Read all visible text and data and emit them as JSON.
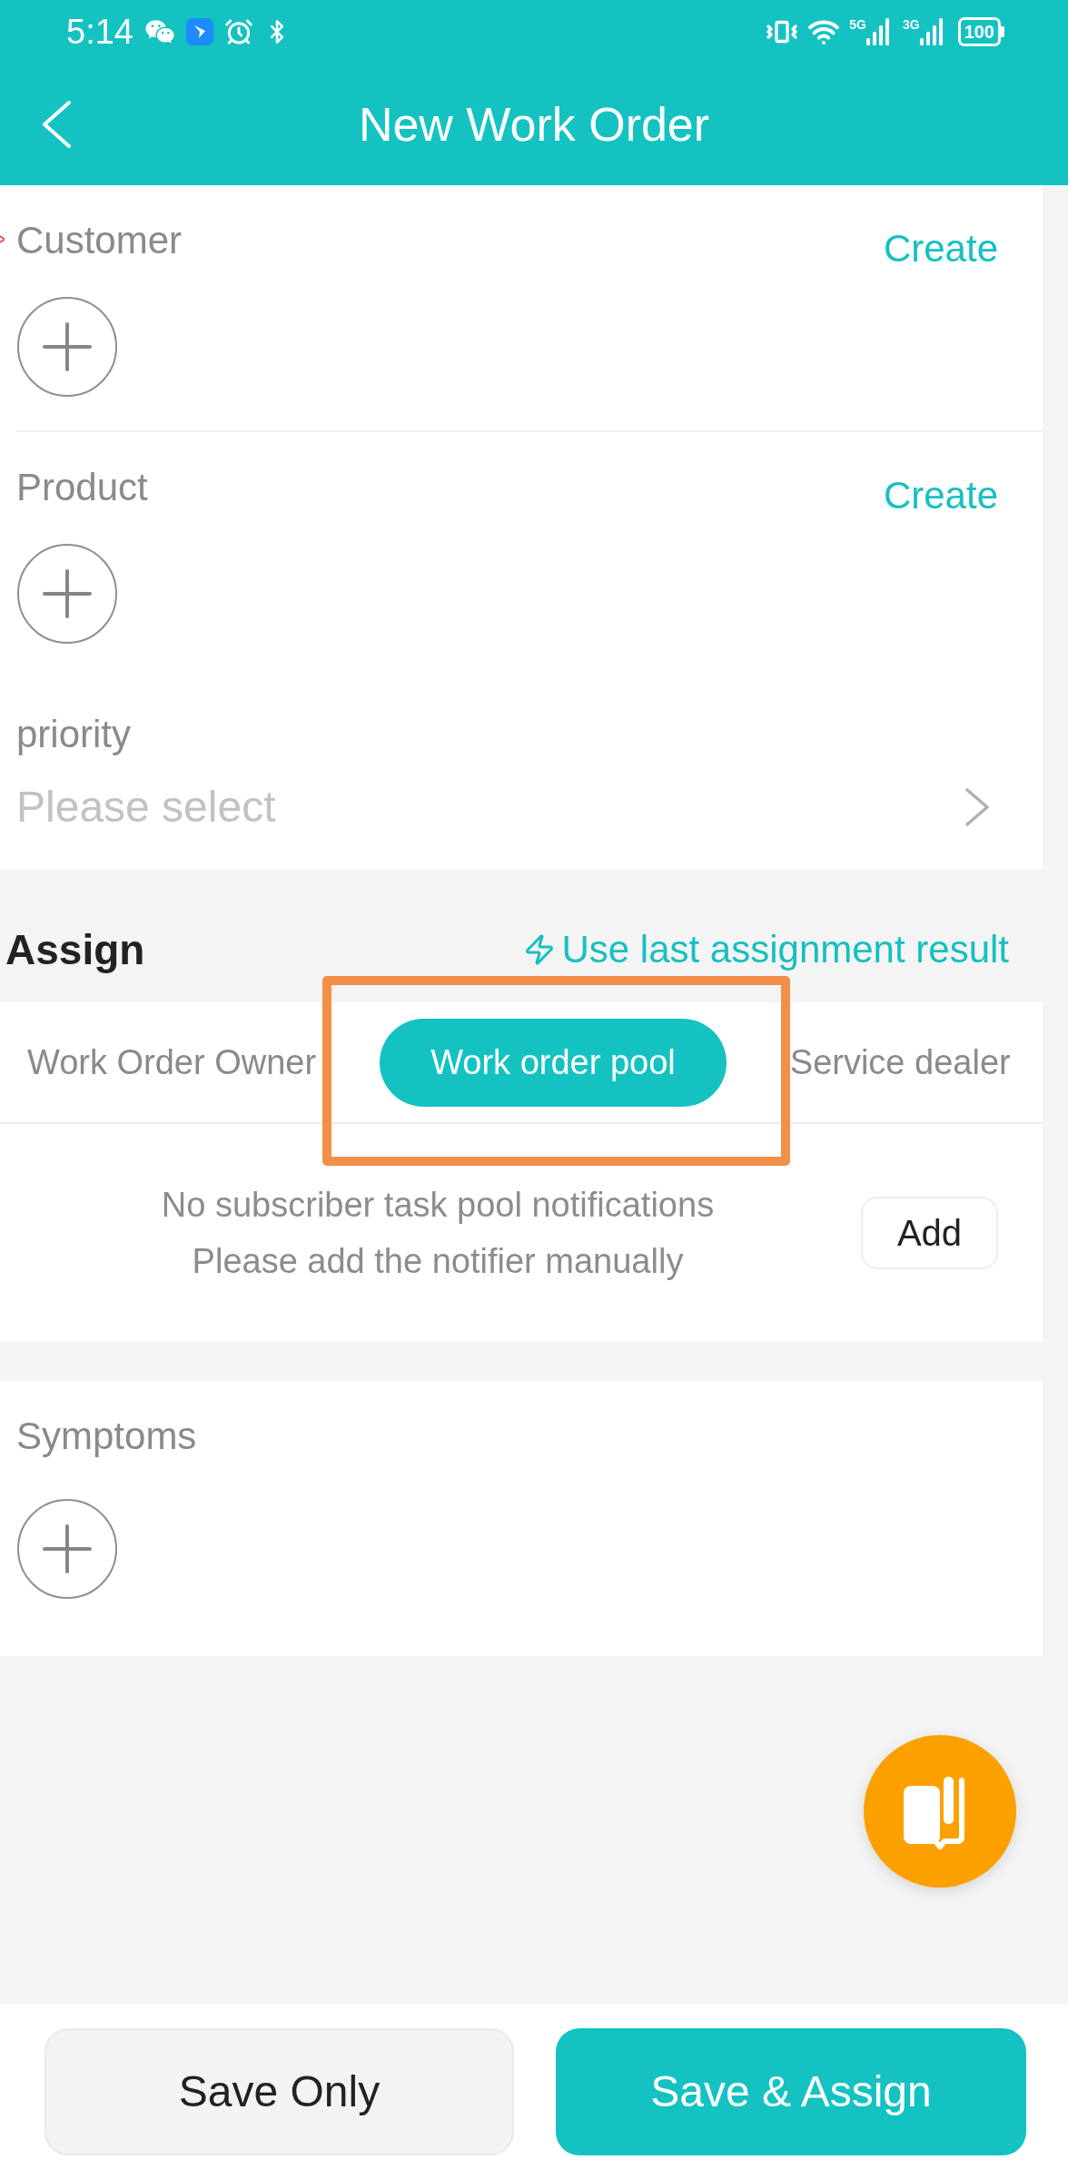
{
  "status_bar": {
    "time": "5:14",
    "network_1": "5G",
    "network_2": "3G",
    "battery": "100"
  },
  "header": {
    "title": "New Work Order"
  },
  "form": {
    "groups": [
      {
        "fields": [
          {
            "kind": "picker",
            "label": "Customer",
            "required": true,
            "action": "Create"
          }
        ]
      },
      {
        "fields": [
          {
            "kind": "picker",
            "label": "Product",
            "required": false,
            "action": "Create"
          },
          {
            "kind": "select",
            "label": "priority",
            "placeholder": "Please select"
          }
        ]
      }
    ]
  },
  "assign": {
    "title": "Assign",
    "quick_action": "Use last assignment result",
    "tabs": [
      {
        "label": "Work Order Owner",
        "selected": false
      },
      {
        "label": "Work order pool",
        "selected": true
      },
      {
        "label": "Service dealer",
        "selected": false
      }
    ],
    "empty_message": [
      "No subscriber task pool notifications",
      "Please add the notifier manually"
    ],
    "add_button": "Add"
  },
  "symptoms": {
    "label": "Symptoms"
  },
  "buttons": [
    {
      "label": "Save Only",
      "kind": "secondary"
    },
    {
      "label": "Save & Assign",
      "kind": "primary"
    }
  ]
}
